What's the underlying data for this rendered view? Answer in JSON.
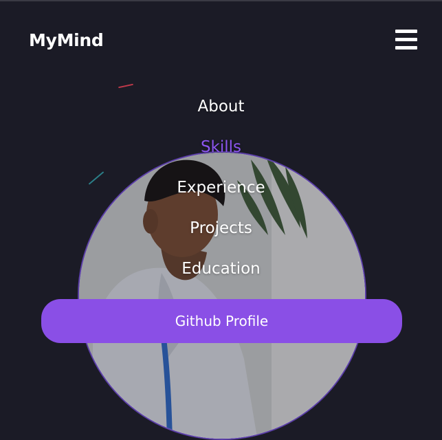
{
  "header": {
    "brand": "MyMind",
    "menu_icon": "hamburger-icon"
  },
  "nav": {
    "items": [
      {
        "label": "About",
        "active": false
      },
      {
        "label": "Skills",
        "active": true
      },
      {
        "label": "Experience",
        "active": false
      },
      {
        "label": "Projects",
        "active": false
      },
      {
        "label": "Education",
        "active": false
      }
    ],
    "cta_label": "Github Profile"
  },
  "colors": {
    "background": "#1b1b26",
    "accent": "#8a4fe6",
    "active_link": "#8b55ee",
    "text": "#ffffff"
  }
}
